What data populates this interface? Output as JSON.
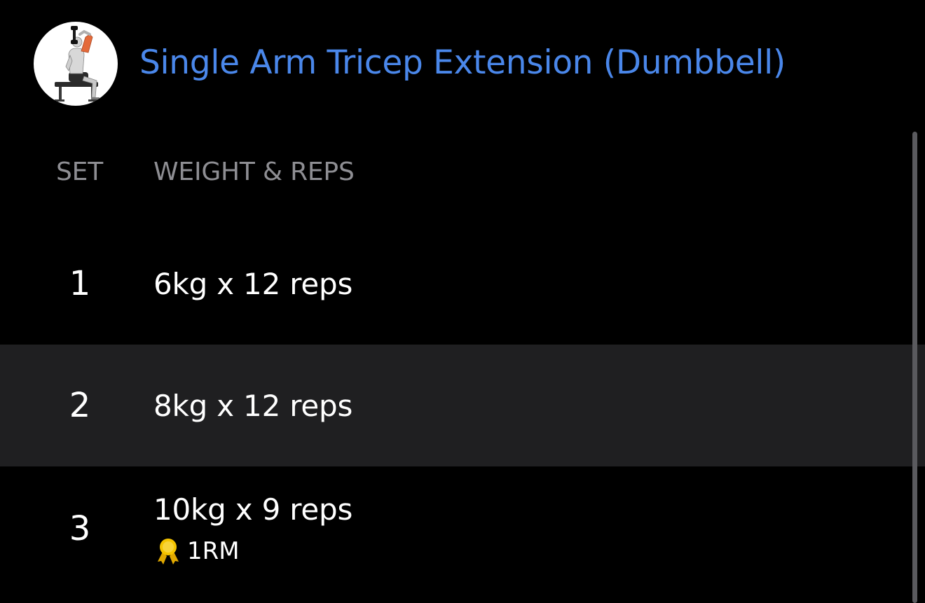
{
  "exercise": {
    "title": "Single Arm Tricep Extension (Dumbbell)",
    "thumbnail_icon": "seated-tricep-extension-figure-icon",
    "title_color": "#4a87ea"
  },
  "columns": {
    "set": "SET",
    "weight_reps": "WEIGHT & REPS"
  },
  "sets": [
    {
      "number": "1",
      "weight_reps": "6kg x 12 reps"
    },
    {
      "number": "2",
      "weight_reps": "8kg x 12 reps",
      "highlighted": true
    },
    {
      "number": "3",
      "weight_reps": "10kg x 9 reps",
      "badge": {
        "icon": "medal-icon",
        "label": "1RM"
      }
    }
  ],
  "colors": {
    "background": "#000000",
    "highlight_row": "#1f1f21",
    "muted_text": "#8e8e93",
    "medal": "#f5c400"
  }
}
